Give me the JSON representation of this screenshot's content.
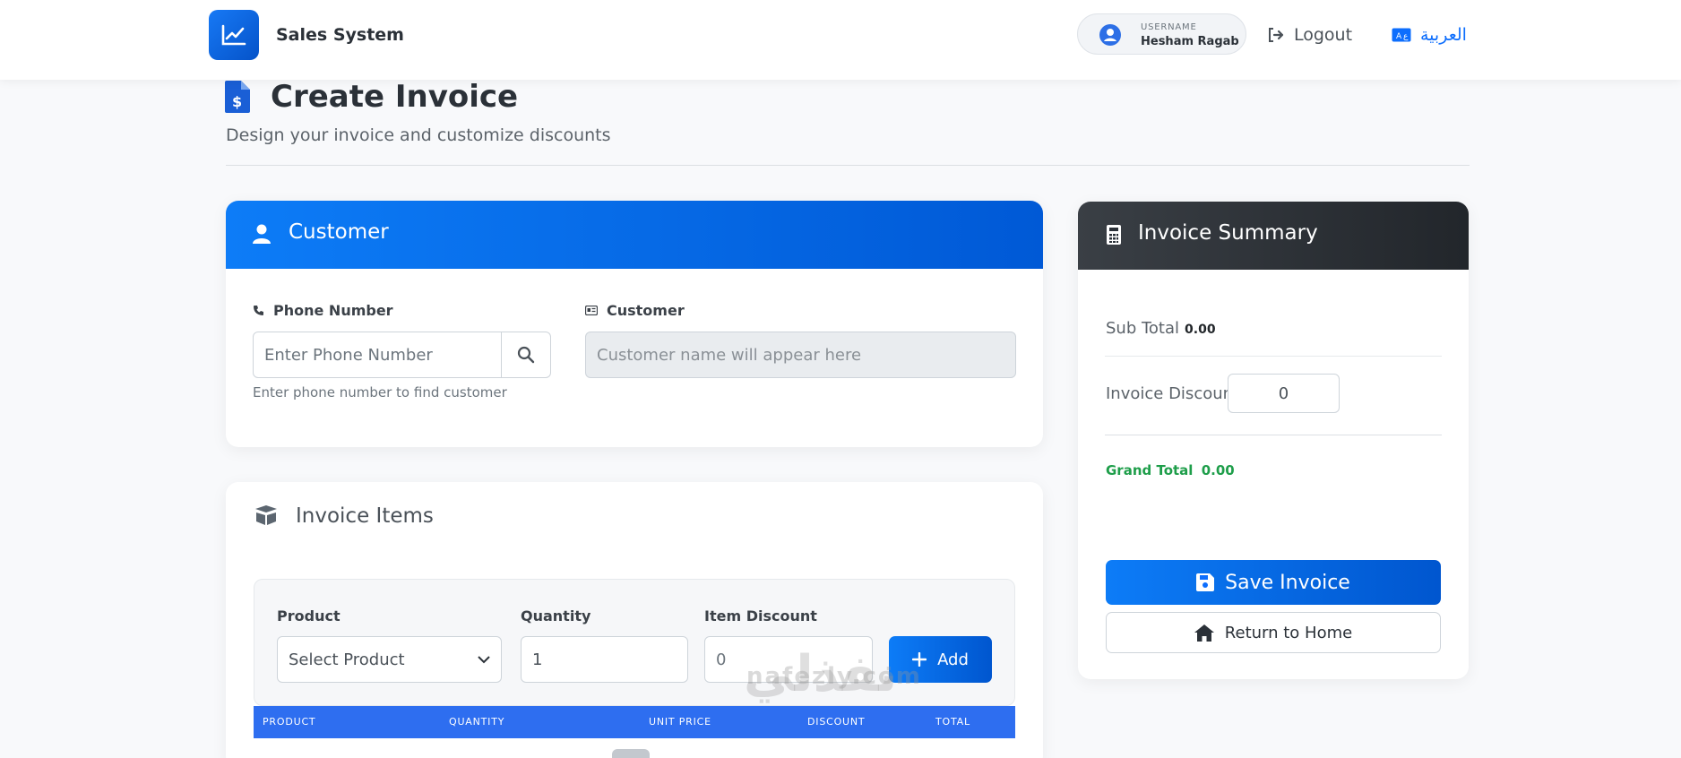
{
  "app": {
    "brand": "Sales System",
    "user_label": "USERNAME",
    "user_name": "Hesham Ragab",
    "logout": "Logout",
    "language": "العربية"
  },
  "page": {
    "title": "Create Invoice",
    "subtitle": "Design your invoice and customize discounts"
  },
  "customer_card": {
    "title": "Customer",
    "phone_label": "Phone Number",
    "phone_placeholder": "Enter Phone Number",
    "phone_help": "Enter phone number to find customer",
    "customer_label": "Customer",
    "customer_placeholder": "Customer name will appear here"
  },
  "items_card": {
    "title": "Invoice Items",
    "product_label": "Product",
    "product_selected": "Select Product",
    "quantity_label": "Quantity",
    "quantity_value": "1",
    "discount_label": "Item Discount",
    "discount_value": "0",
    "add_label": "Add",
    "columns": [
      "PRODUCT",
      "QUANTITY",
      "UNIT PRICE",
      "DISCOUNT",
      "TOTAL"
    ]
  },
  "summary_card": {
    "title": "Invoice Summary",
    "subtotal_label": "Sub Total",
    "subtotal_value": "0.00",
    "discount_label": "Invoice Discount",
    "discount_value": "0",
    "grand_label": "Grand Total",
    "grand_value": "0.00",
    "save_label": "Save Invoice",
    "home_label": "Return to Home"
  },
  "watermark": {
    "ar": "نفذلي",
    "en": "nafezly.com"
  },
  "colors": {
    "primary": "#0d6efd",
    "success": "#1e9e4a",
    "dark": "#2b3138"
  }
}
